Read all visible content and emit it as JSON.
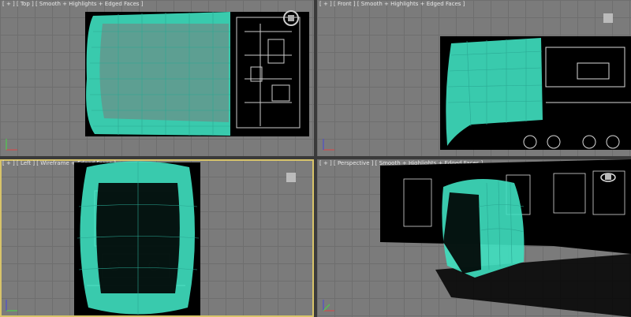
{
  "viewports": {
    "top": {
      "label": "[ + ] [ Top ] [ Smooth + Highlights + Edged Faces ]"
    },
    "front": {
      "label": "[ + ] [ Front ] [ Smooth + Highlights + Edged Faces ]"
    },
    "left": {
      "label": "[ + ] [ Left ] [ Wireframe + Edged Faces ]"
    },
    "perspective": {
      "label": "[ + ] [ Perspective ] [ Smooth + Highlights + Edged Faces ]"
    }
  },
  "active_viewport": "left",
  "colors": {
    "viewport_bg": "#7b7b7b",
    "grid": "#6e6e6e",
    "mesh": "#3fe0c0",
    "wire": "#2aa893",
    "blueprint_bg": "#000000",
    "blueprint_line": "#ffffff",
    "active_border": "#d8c46a"
  },
  "icons": [
    "viewcube-icon",
    "axis-tripod-icon",
    "orbit-gizmo-icon"
  ]
}
